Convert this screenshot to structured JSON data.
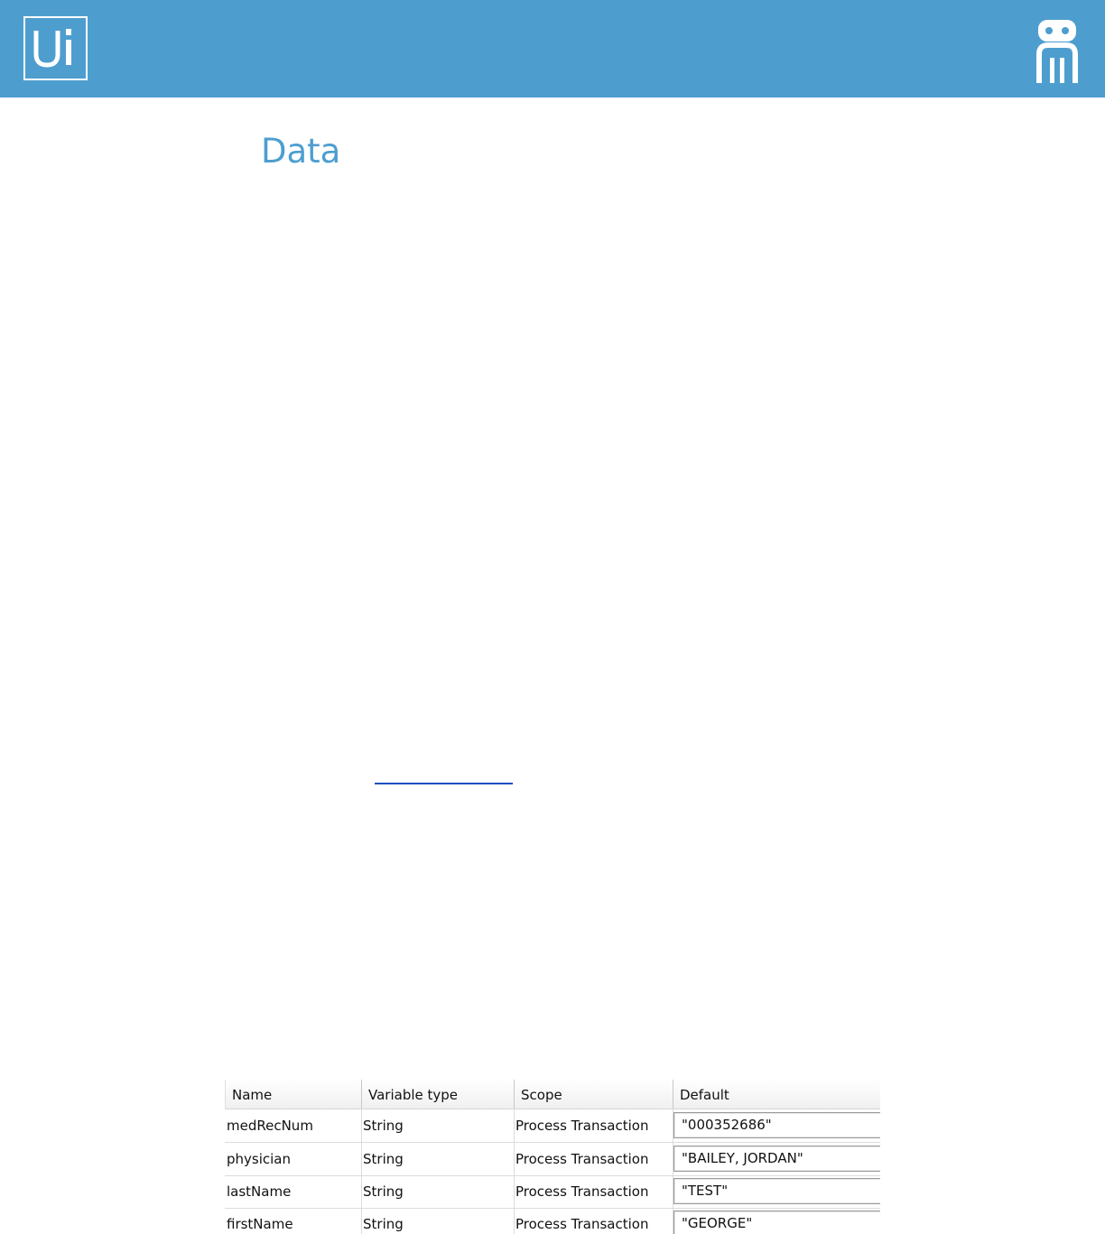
{
  "header": {
    "logo_text": "Ui",
    "brand_color": "#4d9ecf",
    "robot_icon": "robot-icon"
  },
  "page": {
    "title": "Data"
  },
  "table": {
    "columns": [
      "Name",
      "Variable type",
      "Scope",
      "Default"
    ],
    "rows": [
      {
        "name": "medRecNum",
        "type": "String",
        "scope": "Process Transaction",
        "default": "\"000352686\""
      },
      {
        "name": "physician",
        "type": "String",
        "scope": "Process Transaction",
        "default": "\"BAILEY, JORDAN\""
      },
      {
        "name": "lastName",
        "type": "String",
        "scope": "Process Transaction",
        "default": "\"TEST\""
      },
      {
        "name": "firstName",
        "type": "String",
        "scope": "Process Transaction",
        "default": "\"GEORGE\""
      }
    ]
  }
}
